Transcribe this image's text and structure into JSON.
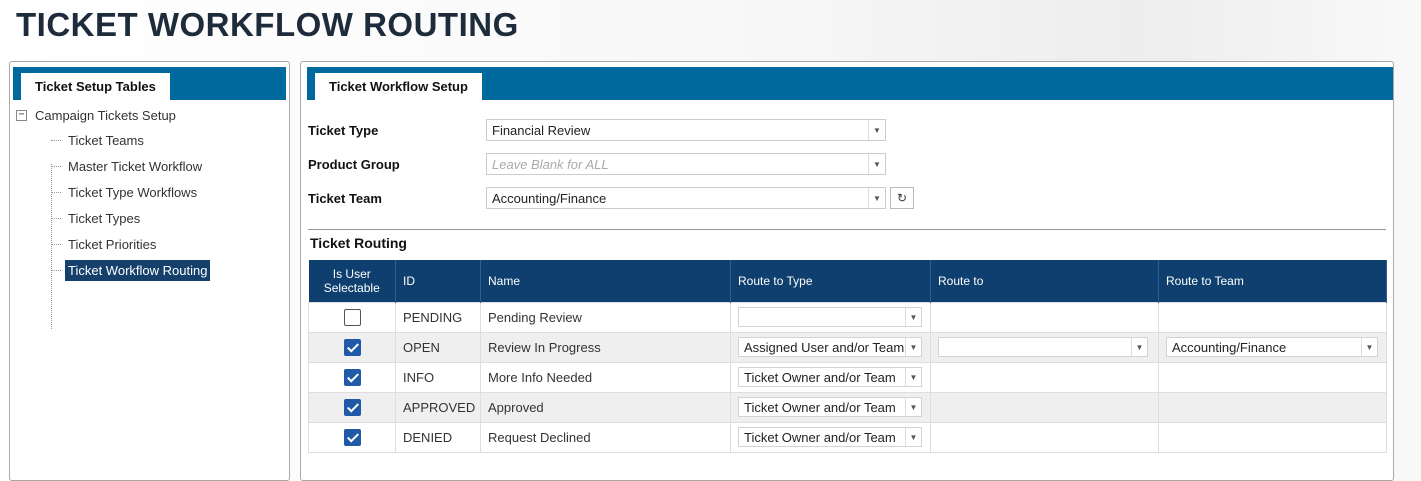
{
  "page_title": "TICKET WORKFLOW ROUTING",
  "left_panel": {
    "tab_label": "Ticket Setup Tables",
    "tree_root": "Campaign Tickets Setup",
    "tree_items": [
      {
        "label": "Ticket Teams",
        "selected": false
      },
      {
        "label": "Master Ticket Workflow",
        "selected": false
      },
      {
        "label": "Ticket Type Workflows",
        "selected": false
      },
      {
        "label": "Ticket Types",
        "selected": false
      },
      {
        "label": "Ticket Priorities",
        "selected": false
      },
      {
        "label": "Ticket Workflow Routing",
        "selected": true
      }
    ]
  },
  "right_panel": {
    "tab_label": "Ticket Workflow Setup",
    "ticket_type": {
      "label": "Ticket Type",
      "value": "Financial Review"
    },
    "product_group": {
      "label": "Product Group",
      "placeholder": "Leave Blank for ALL"
    },
    "ticket_team": {
      "label": "Ticket Team",
      "value": "Accounting/Finance"
    },
    "routing_title": "Ticket Routing",
    "columns": [
      "Is User Selectable",
      "ID",
      "Name",
      "Route to Type",
      "Route to",
      "Route to Team"
    ],
    "rows": [
      {
        "selectable": false,
        "id": "PENDING",
        "name": "Pending Review",
        "route_type": "",
        "route_to": null,
        "route_team": null
      },
      {
        "selectable": true,
        "id": "OPEN",
        "name": "Review In Progress",
        "route_type": "Assigned User and/or Team",
        "route_to": "",
        "route_team": "Accounting/Finance"
      },
      {
        "selectable": true,
        "id": "INFO",
        "name": "More Info Needed",
        "route_type": "Ticket Owner and/or Team",
        "route_to": null,
        "route_team": null
      },
      {
        "selectable": true,
        "id": "APPROVED",
        "name": "Approved",
        "route_type": "Ticket Owner and/or Team",
        "route_to": null,
        "route_team": null
      },
      {
        "selectable": true,
        "id": "DENIED",
        "name": "Request Declined",
        "route_type": "Ticket Owner and/or Team",
        "route_to": null,
        "route_team": null
      }
    ]
  },
  "icons": {
    "expander": "collapse-icon",
    "dropdown": "chevron-down-icon",
    "refresh": "refresh-icon",
    "checkbox": "checkbox-icon"
  },
  "colors": {
    "tab_bar": "#006a9e",
    "grid_header": "#0e3f6e",
    "tree_selected": "#14406b",
    "checkbox_checked": "#1e5aa8"
  }
}
